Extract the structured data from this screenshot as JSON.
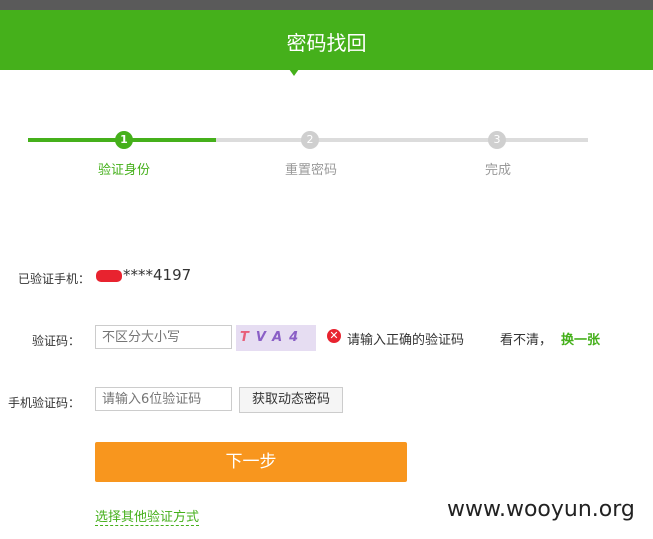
{
  "header": {
    "title": "密码找回"
  },
  "steps": [
    {
      "num": "1",
      "label": "验证身份"
    },
    {
      "num": "2",
      "label": "重置密码"
    },
    {
      "num": "3",
      "label": "完成"
    }
  ],
  "form": {
    "phone_label": "已验证手机：",
    "phone_value": "****4197",
    "captcha_label": "验证码：",
    "captcha_placeholder": "不区分大小写",
    "captcha_image_text": [
      "T",
      "V",
      "A",
      "4"
    ],
    "captcha_error": "请输入正确的验证码",
    "unclear_text": "看不清，",
    "change_link": "换一张",
    "sms_label": "手机验证码：",
    "sms_placeholder": "请输入6位验证码",
    "sms_button": "获取动态密码",
    "next_button": "下一步",
    "other_method_link": "选择其他验证方式"
  },
  "watermark": "www.wooyun.org",
  "colors": {
    "brand_green": "#45b01b",
    "accent_orange": "#f8961e",
    "error_red": "#e8232f"
  },
  "icons": {
    "error": "error-circle-icon"
  }
}
